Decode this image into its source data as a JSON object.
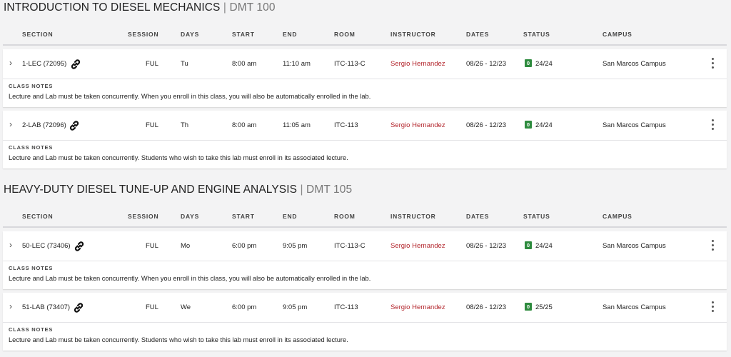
{
  "headers": {
    "section": "SECTION",
    "session": "SESSION",
    "days": "DAYS",
    "start": "START",
    "end": "END",
    "room": "ROOM",
    "instructor": "INSTRUCTOR",
    "dates": "DATES",
    "status": "STATUS",
    "campus": "CAMPUS"
  },
  "notes_label": "CLASS NOTES",
  "courses": [
    {
      "title": "INTRODUCTION TO DIESEL MECHANICS",
      "separator": " | ",
      "code": "DMT 100",
      "sections": [
        {
          "section": "1-LEC (72095)",
          "session": "FUL",
          "days": "Tu",
          "start": "8:00 am",
          "end": "11:10 am",
          "room": "ITC-113-C",
          "instructor": "Sergio Hernandez",
          "dates": "08/26 - 12/23",
          "status_badge": "0",
          "status": "24/24",
          "campus": "San Marcos Campus",
          "notes": "Lecture and Lab must be taken concurrently. When you enroll in this class, you will also be automatically enrolled in the lab."
        },
        {
          "section": "2-LAB (72096)",
          "session": "FUL",
          "days": "Th",
          "start": "8:00 am",
          "end": "11:05 am",
          "room": "ITC-113",
          "instructor": "Sergio Hernandez",
          "dates": "08/26 - 12/23",
          "status_badge": "0",
          "status": "24/24",
          "campus": "San Marcos Campus",
          "notes": "Lecture and Lab must be taken concurrently. Students who wish to take this lab must enroll in its associated lecture."
        }
      ]
    },
    {
      "title": "HEAVY-DUTY DIESEL TUNE-UP AND ENGINE ANALYSIS",
      "separator": " | ",
      "code": "DMT 105",
      "sections": [
        {
          "section": "50-LEC (73406)",
          "session": "FUL",
          "days": "Mo",
          "start": "6:00 pm",
          "end": "9:05 pm",
          "room": "ITC-113-C",
          "instructor": "Sergio Hernandez",
          "dates": "08/26 - 12/23",
          "status_badge": "0",
          "status": "24/24",
          "campus": "San Marcos Campus",
          "notes": "Lecture and Lab must be taken concurrently. When you enroll in this class, you will also be automatically enrolled in the lab."
        },
        {
          "section": "51-LAB (73407)",
          "session": "FUL",
          "days": "We",
          "start": "6:00 pm",
          "end": "9:05 pm",
          "room": "ITC-113",
          "instructor": "Sergio Hernandez",
          "dates": "08/26 - 12/23",
          "status_badge": "0",
          "status": "25/25",
          "campus": "San Marcos Campus",
          "notes": "Lecture and Lab must be taken concurrently. Students who wish to take this lab must enroll in its associated lecture."
        }
      ]
    }
  ],
  "colors": {
    "instructor_link": "#b3262d",
    "status_badge": "#2e8b3e",
    "page_background": "#f3f3f4"
  },
  "icons": {
    "expand": "chevron-right-icon",
    "linked": "link-icon",
    "menu": "kebab-menu-icon"
  }
}
